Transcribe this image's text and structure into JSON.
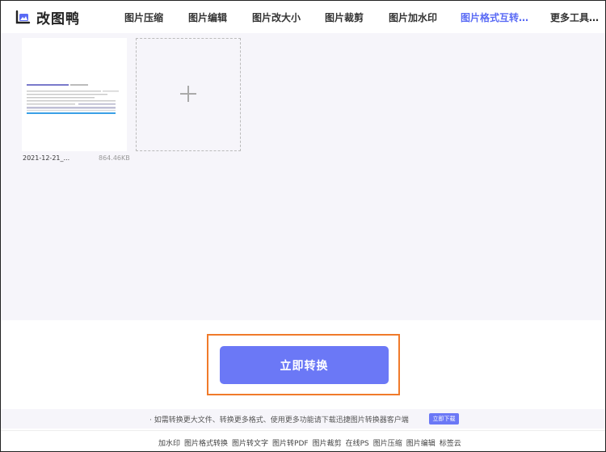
{
  "header": {
    "logo_text": "改图鸭",
    "nav": [
      {
        "label": "图片压缩",
        "active": false
      },
      {
        "label": "图片编辑",
        "active": false
      },
      {
        "label": "图片改大小",
        "active": false
      },
      {
        "label": "图片裁剪",
        "active": false
      },
      {
        "label": "图片加水印",
        "active": false
      },
      {
        "label": "图片格式互转…",
        "active": true
      },
      {
        "label": "更多工具…",
        "active": false
      }
    ]
  },
  "files": [
    {
      "name": "2021-12-21_...",
      "size": "864.46KB"
    }
  ],
  "convert_button": "立即转换",
  "notice": {
    "text": "· 如需转换更大文件、转换更多格式、使用更多功能请下载迅捷图片转换器客户端",
    "download_label": "立即下载"
  },
  "footer_links": [
    "加水印",
    "图片格式转换",
    "图片转文字",
    "图片转PDF",
    "图片裁剪",
    "在线PS",
    "图片压缩",
    "图片编辑",
    "标签云"
  ],
  "colors": {
    "accent": "#6b78f6",
    "highlight": "#f07a2a",
    "active_nav": "#5a6bf5"
  }
}
